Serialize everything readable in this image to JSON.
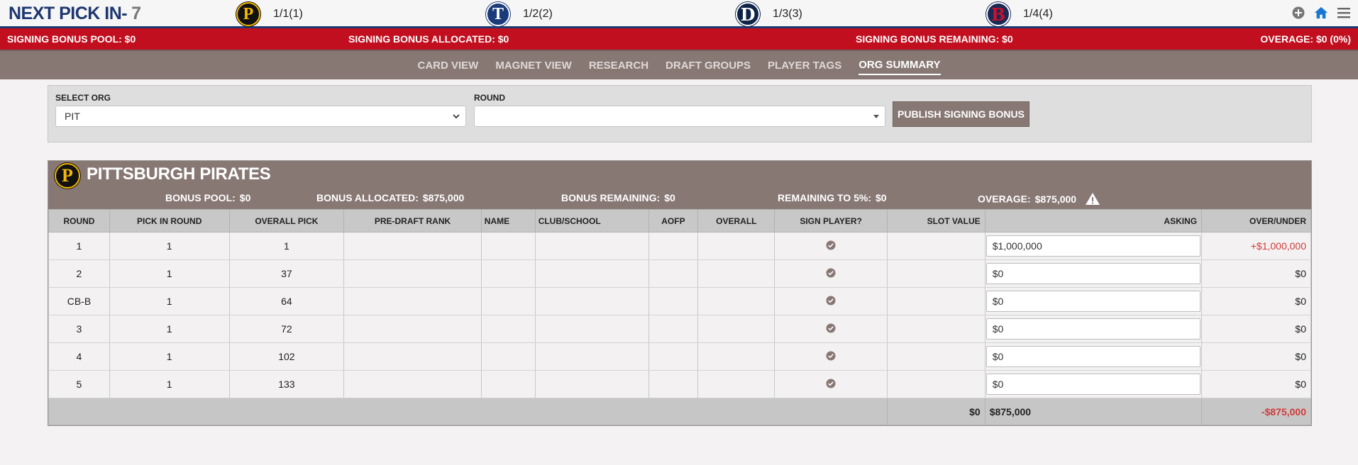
{
  "topbar": {
    "next_pick_label": "NEXT PICK IN-",
    "next_pick_count": "7",
    "picks": [
      {
        "team": "PIT",
        "logo_letter": "P",
        "label": "1/1(1)"
      },
      {
        "team": "TEX",
        "logo_letter": "T",
        "label": "1/2(2)"
      },
      {
        "team": "DET",
        "logo_letter": "D",
        "label": "1/3(3)"
      },
      {
        "team": "BOS",
        "logo_letter": "B",
        "label": "1/4(4)"
      }
    ],
    "icons": [
      "plus-circle-icon",
      "home-icon",
      "hamburger-menu-icon"
    ]
  },
  "bonusbar": {
    "pool": "SIGNING BONUS POOL: $0",
    "allocated": "SIGNING BONUS ALLOCATED: $0",
    "remaining": "SIGNING BONUS REMAINING: $0",
    "overage": "OVERAGE: $0 (0%)"
  },
  "nav": {
    "tabs": [
      {
        "label": "CARD VIEW",
        "active": false
      },
      {
        "label": "MAGNET VIEW",
        "active": false
      },
      {
        "label": "RESEARCH",
        "active": false
      },
      {
        "label": "DRAFT GROUPS",
        "active": false
      },
      {
        "label": "PLAYER TAGS",
        "active": false
      },
      {
        "label": "ORG SUMMARY",
        "active": true
      }
    ]
  },
  "filters": {
    "org_label": "SELECT ORG",
    "org_value": "PIT",
    "round_label": "ROUND",
    "round_value": "",
    "publish_label": "PUBLISH SIGNING BONUS"
  },
  "org": {
    "logo_letter": "P",
    "name": "PITTSBURGH PIRATES",
    "summary": {
      "bonus_pool_label": "BONUS POOL:",
      "bonus_pool": "$0",
      "bonus_allocated_label": "BONUS ALLOCATED:",
      "bonus_allocated": "$875,000",
      "bonus_remaining_label": "BONUS REMAINING:",
      "bonus_remaining": "$0",
      "remaining_5_label": "REMAINING TO 5%:",
      "remaining_5": "$0",
      "overage_label": "OVERAGE:",
      "overage": "$875,000"
    },
    "columns": [
      "ROUND",
      "PICK IN ROUND",
      "OVERALL PICK",
      "PRE-DRAFT RANK",
      "NAME",
      "CLUB/SCHOOL",
      "AOFP",
      "OVERALL",
      "SIGN PLAYER?",
      "SLOT VALUE",
      "ASKING",
      "OVER/UNDER"
    ],
    "rows": [
      {
        "round": "1",
        "pick_in_round": "1",
        "overall_pick": "1",
        "asking": "$1,000,000",
        "over_under": "+$1,000,000"
      },
      {
        "round": "2",
        "pick_in_round": "1",
        "overall_pick": "37",
        "asking": "$0",
        "over_under": "$0"
      },
      {
        "round": "CB-B",
        "pick_in_round": "1",
        "overall_pick": "64",
        "asking": "$0",
        "over_under": "$0"
      },
      {
        "round": "3",
        "pick_in_round": "1",
        "overall_pick": "72",
        "asking": "$0",
        "over_under": "$0"
      },
      {
        "round": "4",
        "pick_in_round": "1",
        "overall_pick": "102",
        "asking": "$0",
        "over_under": "$0"
      },
      {
        "round": "5",
        "pick_in_round": "1",
        "overall_pick": "133",
        "asking": "$0",
        "over_under": "$0"
      }
    ],
    "totals": {
      "slot_value": "$0",
      "asking": "$875,000",
      "over_under": "-$875,000"
    }
  },
  "colors": {
    "navy": "#1e3770",
    "red": "#c20f1f",
    "taupe": "#877874"
  }
}
